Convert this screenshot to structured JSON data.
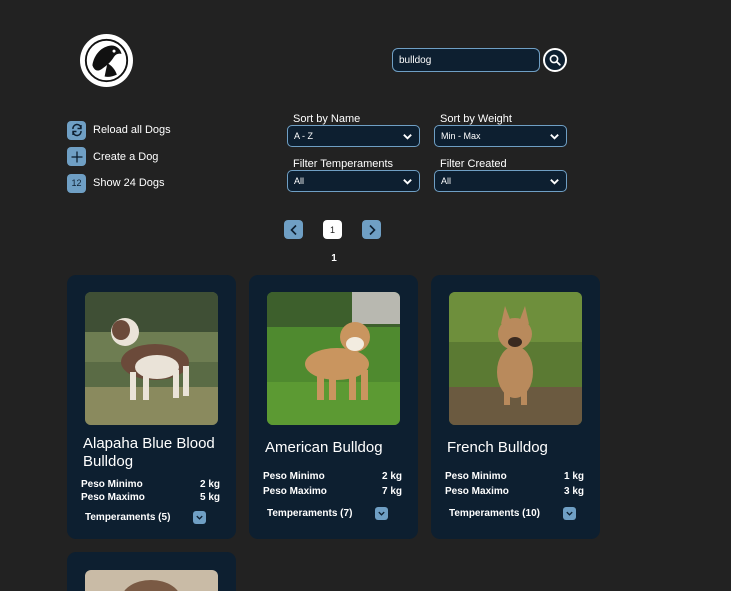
{
  "search": {
    "value": "bulldog",
    "button_icon": "search-icon"
  },
  "actions": [
    {
      "label": "Reload all Dogs",
      "icon": "reload-icon"
    },
    {
      "label": "Create a Dog",
      "icon": "plus-icon"
    },
    {
      "label": "Show 24 Dogs",
      "icon_text": "12"
    }
  ],
  "filters": {
    "sort_name": {
      "label": "Sort by Name",
      "value": "A - Z"
    },
    "sort_weight": {
      "label": "Sort by Weight",
      "value": "Min - Max"
    },
    "temperaments": {
      "label": "Filter Temperaments",
      "value": "All"
    },
    "created": {
      "label": "Filter Created",
      "value": "All"
    }
  },
  "pagination": {
    "page_button": "1",
    "current_page": "1"
  },
  "cards": [
    {
      "name": "Alapaha Blue Blood Bulldog",
      "min_label": "Peso Minimo",
      "min_value": "2 kg",
      "max_label": "Peso Maximo",
      "max_value": "5 kg",
      "temperaments": "Temperaments (5)"
    },
    {
      "name": "American Bulldog",
      "min_label": "Peso Minimo",
      "min_value": "2 kg",
      "max_label": "Peso Maximo",
      "max_value": "7 kg",
      "temperaments": "Temperaments (7)"
    },
    {
      "name": "French Bulldog",
      "min_label": "Peso Minimo",
      "min_value": "1 kg",
      "max_label": "Peso Maximo",
      "max_value": "3 kg",
      "temperaments": "Temperaments (10)"
    }
  ],
  "colors": {
    "background": "#222222",
    "card": "#0d1f30",
    "accent": "#6f9fc4"
  }
}
